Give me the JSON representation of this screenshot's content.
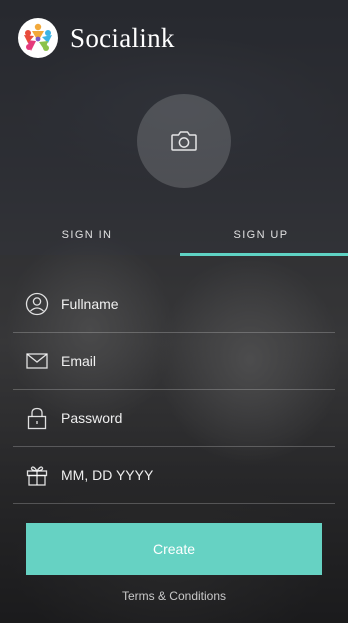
{
  "header": {
    "logo_icon": "colorful-people-logo-icon",
    "app_name": "Socialink"
  },
  "avatar": {
    "icon": "camera-icon"
  },
  "tabs": [
    {
      "label": "SIGN IN",
      "active": false
    },
    {
      "label": "SIGN UP",
      "active": true
    }
  ],
  "form": {
    "fields": [
      {
        "icon": "user-icon",
        "placeholder": "Fullname",
        "value": ""
      },
      {
        "icon": "envelope-icon",
        "placeholder": "Email",
        "value": ""
      },
      {
        "icon": "lock-icon",
        "placeholder": "Password",
        "value": ""
      },
      {
        "icon": "gift-icon",
        "placeholder": "MM, DD YYYY",
        "value": ""
      }
    ],
    "submit_label": "Create"
  },
  "footer": {
    "terms_label": "Terms & Conditions"
  },
  "colors": {
    "accent": "#66d2c3",
    "tab_indicator": "#5fd3c4",
    "text": "#ffffff"
  }
}
